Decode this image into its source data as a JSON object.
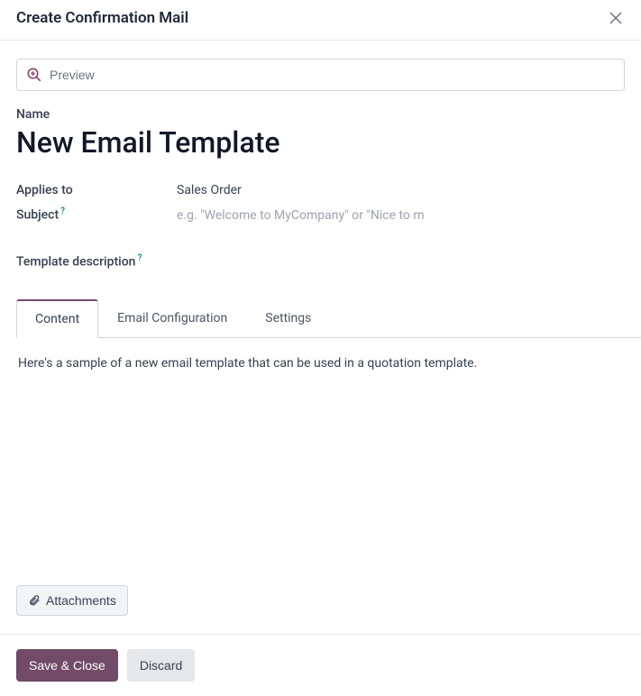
{
  "dialog": {
    "title": "Create Confirmation Mail",
    "close_icon": "close"
  },
  "preview": {
    "label": "Preview"
  },
  "fields": {
    "name_label": "Name",
    "name_value": "New Email Template",
    "applies_label": "Applies to",
    "applies_value": "Sales Order",
    "subject_label": "Subject",
    "subject_help": "?",
    "subject_placeholder": "e.g. \"Welcome to MyCompany\" or \"Nice to m",
    "desc_label": "Template description",
    "desc_help": "?"
  },
  "tabs": {
    "content": "Content",
    "email_config": "Email Configuration",
    "settings": "Settings"
  },
  "content": {
    "body": "Here's a sample of a new email template that can be used in a quotation template."
  },
  "attachments": {
    "label": "Attachments"
  },
  "footer": {
    "save": "Save & Close",
    "discard": "Discard"
  }
}
